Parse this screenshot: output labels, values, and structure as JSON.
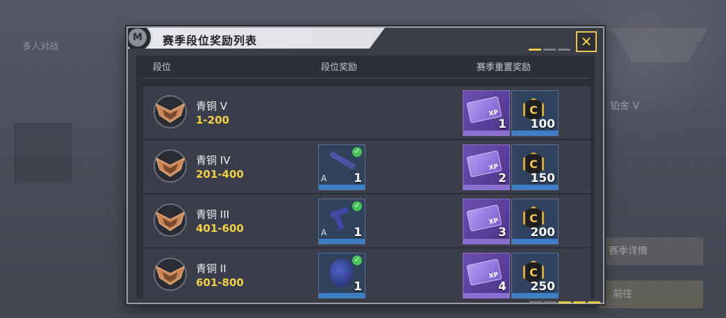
{
  "background": {
    "tab_label": "多人对战",
    "right_rank_label": "铂金 V",
    "right_button_1": "赛季详情",
    "right_button_2": "前往"
  },
  "dialog": {
    "title": "赛季段位奖励列表",
    "close_icon": "close-x-icon",
    "columns": {
      "rank": "段位",
      "rank_reward": "段位奖励",
      "season_reset_reward": "赛季重置奖励"
    },
    "pager_top": [
      true,
      false,
      false
    ],
    "pager_bottom": [
      false,
      false,
      true,
      true,
      true
    ]
  },
  "rows": [
    {
      "rank_name": "青铜 V",
      "range": "1-200",
      "rank_reward": null,
      "xp_qty": "1",
      "coin_qty": "100"
    },
    {
      "rank_name": "青铜 IV",
      "range": "201-400",
      "rank_reward": {
        "icon": "rifle-icon",
        "qty": "1",
        "tier": "A",
        "claimed": true
      },
      "xp_qty": "2",
      "coin_qty": "150"
    },
    {
      "rank_name": "青铜 III",
      "range": "401-600",
      "rank_reward": {
        "icon": "pistol-icon",
        "qty": "1",
        "tier": "A",
        "claimed": true
      },
      "xp_qty": "3",
      "coin_qty": "200"
    },
    {
      "rank_name": "青铜 II",
      "range": "601-800",
      "rank_reward": {
        "icon": "grenade-icon",
        "qty": "1",
        "tier": "",
        "claimed": true
      },
      "xp_qty": "4",
      "coin_qty": "250"
    }
  ],
  "colors": {
    "accent": "#f2cf47",
    "claimed": "#48c45a",
    "xp_purple": "#6c4fb0",
    "item_blue": "#30435c"
  }
}
